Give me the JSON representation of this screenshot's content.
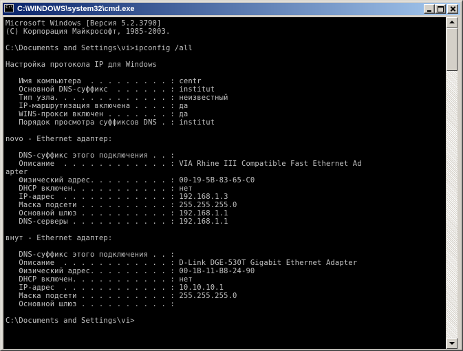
{
  "window": {
    "title": "C:\\WINDOWS\\system32\\cmd.exe",
    "icon_label": "C:\\",
    "icon": "console-icon"
  },
  "titlebar_buttons": {
    "minimize": "minimize-icon",
    "maximize": "maximize-icon",
    "close": "close-icon"
  },
  "console": {
    "lines": [
      "Microsoft Windows [Версия 5.2.3790]",
      "(C) Корпорация Майкрософт, 1985-2003.",
      "",
      "C:\\Documents and Settings\\vi>ipconfig /all",
      "",
      "Настройка протокола IP для Windows",
      "",
      "   Имя компьютера  . . . . . . . . . : centr",
      "   Основной DNS-суффикс  . . . . . . : institut",
      "   Тип узла. . . . . . . . . . . . . : неизвестный",
      "   IP-маршрутизация включена . . . . : да",
      "   WINS-прокси включен . . . . . . . : да",
      "   Порядок просмотра суффиксов DNS . : institut",
      "",
      "novo - Ethernet адаптер:",
      "",
      "   DNS-суффикс этого подключения . . :",
      "   Описание  . . . . . . . . . . . . : VIA Rhine III Compatible Fast Ethernet Ad",
      "apter",
      "   Физический адрес. . . . . . . . . : 00-19-5B-83-65-C0",
      "   DHCP включен. . . . . . . . . . . : нет",
      "   IP-адрес  . . . . . . . . . . . . : 192.168.1.3",
      "   Маска подсети . . . . . . . . . . : 255.255.255.0",
      "   Основной шлюз . . . . . . . . . . : 192.168.1.1",
      "   DNS-серверы . . . . . . . . . . . : 192.168.1.1",
      "",
      "внут - Ethernet адаптер:",
      "",
      "   DNS-суффикс этого подключения . . :",
      "   Описание  . . . . . . . . . . . . : D-Link DGE-530T Gigabit Ethernet Adapter",
      "   Физический адрес. . . . . . . . . : 00-1B-11-B8-24-90",
      "   DHCP включен. . . . . . . . . . . : нет",
      "   IP-адрес  . . . . . . . . . . . . : 10.10.10.1",
      "   Маска подсети . . . . . . . . . . : 255.255.255.0",
      "   Основной шлюз . . . . . . . . . . :",
      "",
      "C:\\Documents and Settings\\vi>"
    ]
  },
  "scrollbar": {
    "up_icon": "scroll-up-arrow-icon",
    "down_icon": "scroll-down-arrow-icon"
  }
}
